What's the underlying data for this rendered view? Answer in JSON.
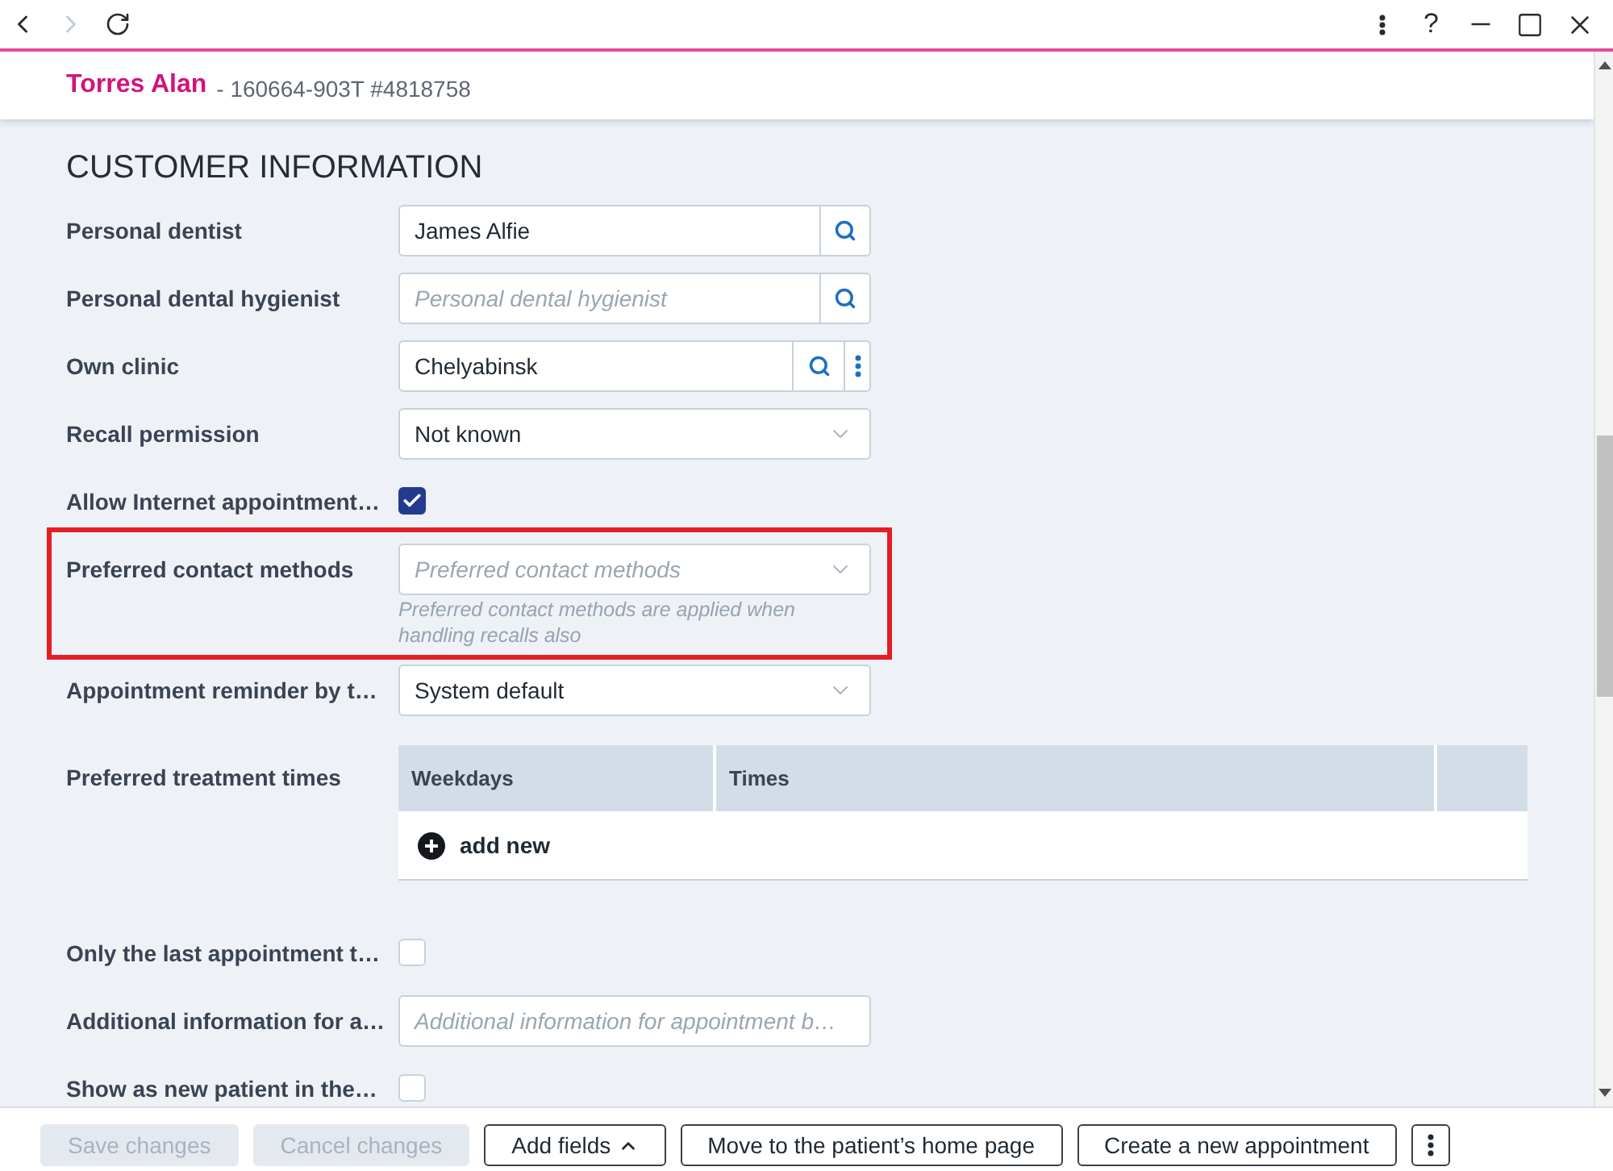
{
  "toolbar": {
    "forward_disabled": true,
    "help_label": "?"
  },
  "patient": {
    "name": "Torres Alan",
    "record": "- 160664-903T #4818758"
  },
  "section_title": "CUSTOMER INFORMATION",
  "fields": [
    {
      "label": "Personal dentist",
      "kind": "lookup",
      "value": "James Alfie",
      "menu": false,
      "highlighted": false
    },
    {
      "label": "Personal dental hygienist",
      "kind": "lookup",
      "placeholder": "Personal dental hygienist",
      "menu": false,
      "highlighted": false
    },
    {
      "label": "Own clinic",
      "kind": "lookup",
      "value": "Chelyabinsk",
      "menu": true,
      "highlighted": false
    },
    {
      "label": "Recall permission",
      "kind": "select",
      "value": "Not known",
      "highlighted": false
    },
    {
      "label": "Allow Internet appointment…",
      "kind": "checkbox",
      "checked": true,
      "highlighted": false
    },
    {
      "label": "Preferred contact methods",
      "kind": "select",
      "placeholder": "Preferred contact methods",
      "hint": "Preferred contact methods are applied when handling recalls also",
      "highlighted": true
    },
    {
      "label": "Appointment reminder by t…",
      "kind": "select",
      "value": "System default",
      "highlighted": false
    },
    {
      "label": "Preferred treatment times",
      "kind": "table",
      "columns": [
        "Weekdays",
        "Times"
      ],
      "add_label": "add new",
      "highlighted": false
    },
    {
      "label": "Only the last appointment t…",
      "kind": "checkbox",
      "checked": false,
      "highlighted": false
    },
    {
      "label": "Additional information for a…",
      "kind": "text",
      "placeholder": "Additional information for appointment b…",
      "highlighted": false
    },
    {
      "label": "Show as new patient in the…",
      "kind": "checkbox",
      "checked": false,
      "highlighted": false
    }
  ],
  "footer": {
    "buttons": [
      {
        "label": "Save changes",
        "kind": "plain",
        "disabled": true
      },
      {
        "label": "Cancel changes",
        "kind": "plain",
        "disabled": true
      },
      {
        "label": "Add fields",
        "kind": "dropdown",
        "disabled": false
      },
      {
        "label": "Move to the patient’s home page",
        "kind": "plain",
        "disabled": false
      },
      {
        "label": "Create a new appointment",
        "kind": "plain",
        "disabled": false
      },
      {
        "kind": "more",
        "disabled": false
      }
    ]
  }
}
